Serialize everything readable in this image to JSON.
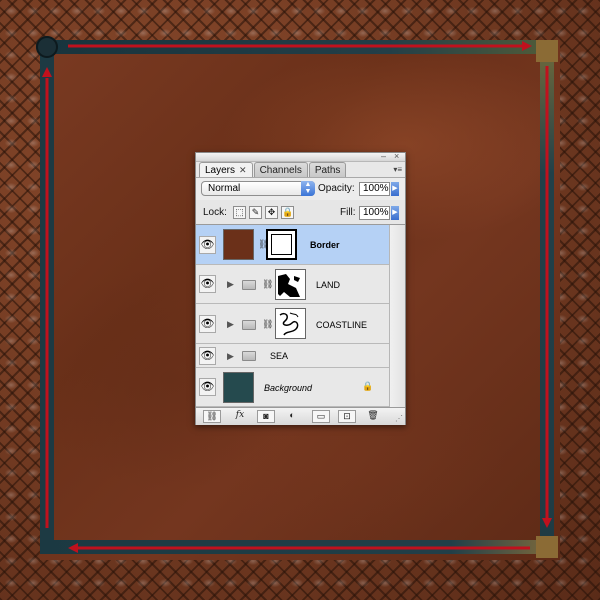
{
  "colors": {
    "leather": "#6b3019",
    "frame": "#1f3a44",
    "arrow": "#c0111d",
    "selected_row": "#b5d1f5",
    "blend_arrow": "#3b75d7"
  },
  "panel": {
    "tabs": [
      {
        "label": "Layers",
        "active": true
      },
      {
        "label": "Channels",
        "active": false
      },
      {
        "label": "Paths",
        "active": false
      }
    ],
    "blend_mode": "Normal",
    "opacity_label": "Opacity:",
    "opacity_value": "100%",
    "lock_label": "Lock:",
    "fill_label": "Fill:",
    "fill_value": "100%",
    "lock_icons": [
      "transparency-lock-icon",
      "brush-lock-icon",
      "move-lock-icon",
      "padlock-icon"
    ],
    "bottom_icons": [
      "link-icon",
      "fx-icon",
      "mask-icon",
      "adjustment-icon",
      "folder-icon",
      "new-layer-icon",
      "trash-icon"
    ],
    "fx_text": "fx"
  },
  "layers": [
    {
      "name": "Border",
      "type": "layer",
      "selected": true,
      "visible": true,
      "has_mask": true
    },
    {
      "name": "LAND",
      "type": "group",
      "selected": false,
      "visible": true,
      "has_mask": true
    },
    {
      "name": "COASTLINE",
      "type": "group",
      "selected": false,
      "visible": true,
      "has_mask": true
    },
    {
      "name": "SEA",
      "type": "group",
      "selected": false,
      "visible": true,
      "has_mask": false
    },
    {
      "name": "Background",
      "type": "background",
      "selected": false,
      "visible": true,
      "locked": true
    }
  ]
}
